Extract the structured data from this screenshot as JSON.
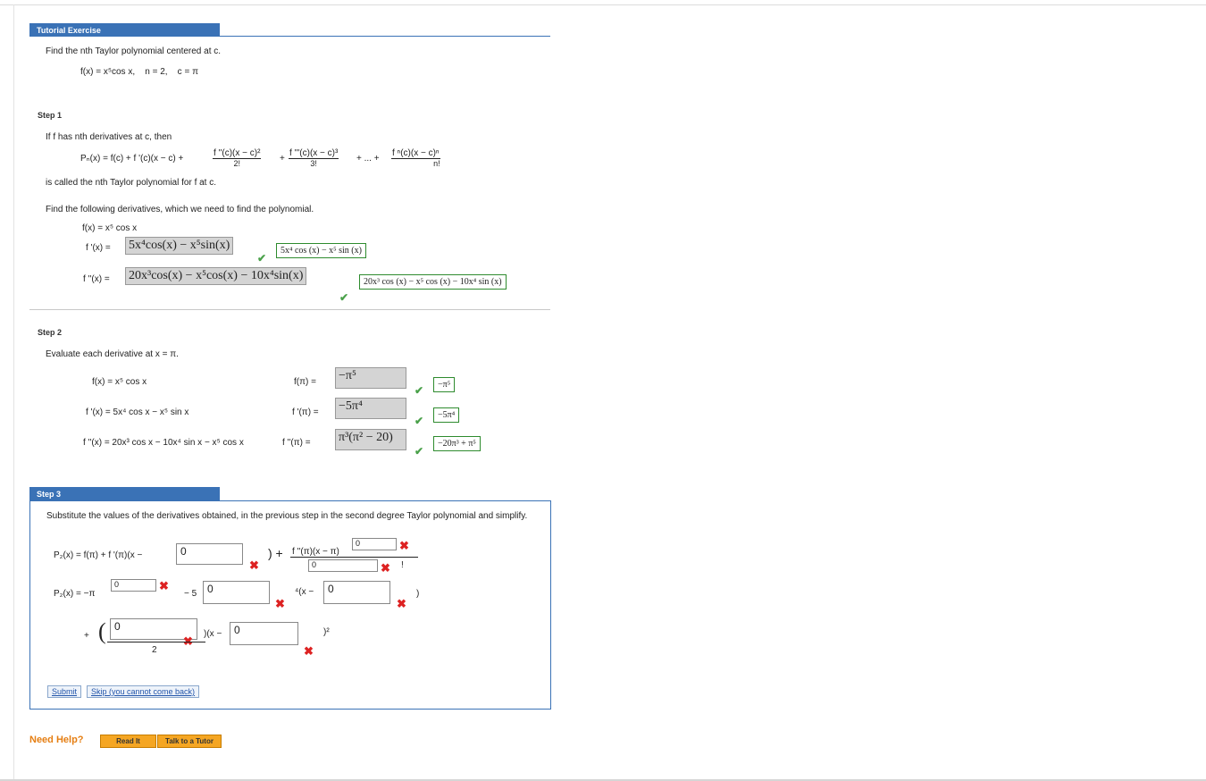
{
  "header": {
    "title": "Tutorial Exercise"
  },
  "problem": {
    "instruction": "Find the nth Taylor polynomial centered at c.",
    "function": "f(x) = x⁵cos x,",
    "n_value": "n = 2,",
    "c_value": "c = π"
  },
  "step1": {
    "label": "Step 1",
    "intro": "If f has nth derivatives at c, then",
    "formula_lhs": "Pₙ(x) = f(c) + f '(c)(x − c) +",
    "term2_num": "f ''(c)(x − c)²",
    "term2_den": "2!",
    "plus1": "+",
    "term3_num": "f '''(c)(x − c)³",
    "term3_den": "3!",
    "ellipsis": "+ ... +",
    "termn_num": "f ⁿ(c)(x − c)ⁿ",
    "termn_den": "n!",
    "outro": "is called the nth Taylor polynomial for f at c.",
    "find_text": "Find the following derivatives, which we need to find the polynomial.",
    "f_label": "f(x) = x⁵ cos x",
    "fp_label": "f '(x) =",
    "fp_answer": "5x⁴cos(x) − x⁵sin(x)",
    "fp_correct": "5x⁴ cos (x) − x⁵ sin (x)",
    "fpp_label": "f ''(x) =",
    "fpp_answer": "20x³cos(x) − x⁵cos(x) − 10x⁴sin(x)",
    "fpp_correct": "20x³ cos (x) − x⁵ cos (x) − 10x⁴ sin (x)"
  },
  "step2": {
    "label": "Step 2",
    "instruction": "Evaluate each derivative at x = π.",
    "rows": [
      {
        "left": "f(x) = x⁵ cos x",
        "mid": "f(π)  =",
        "answer": "−π⁵",
        "correct": "−π⁵"
      },
      {
        "left": "f '(x) = 5x⁴ cos x − x⁵ sin x",
        "mid": "f '(π)  =",
        "answer": "−5π⁴",
        "correct": "−5π⁴"
      },
      {
        "left": "f ''(x) = 20x³ cos x − 10x⁴ sin x − x⁵ cos x",
        "mid": "f ''(π) =",
        "answer": "π³(π² − 20)",
        "correct": "−20π³ + π⁵"
      }
    ]
  },
  "step3": {
    "label": "Step 3",
    "instruction": "Substitute the values of the derivatives obtained, in the previous step in the second degree Taylor polynomial and simplify.",
    "line1_lhs": "P₂(x)   =   f(π) + f '(π)(x −",
    "line1_input": "0",
    "line1_close": ")  +",
    "line1_frac_num": "f ''(π)(x − π)",
    "line1_exp_input": "0",
    "line1_den_input": "0",
    "bang": "!",
    "line2_lhs": "P₂(x)   =   −π",
    "line2_exp_input": "0",
    "line2_minus5": "− 5",
    "line2_input": "0",
    "line2_mid": "⁴(x −",
    "line2_input2": "0",
    "line2_close": ")",
    "line3_plus": "+",
    "line3_input": "0",
    "line3_den": "2",
    "line3_mid": ")(x −",
    "line3_input2": "0",
    "line3_close": ")²",
    "submit_label": "Submit",
    "skip_label": "Skip (you cannot come back)"
  },
  "help": {
    "title": "Need Help?",
    "read_label": "Read It",
    "tutor_label": "Talk to a Tutor"
  },
  "colors": {
    "accent": "#3a72b6",
    "correct": "#4aa14a",
    "incorrect": "#d22222",
    "help": "#e57e12"
  }
}
